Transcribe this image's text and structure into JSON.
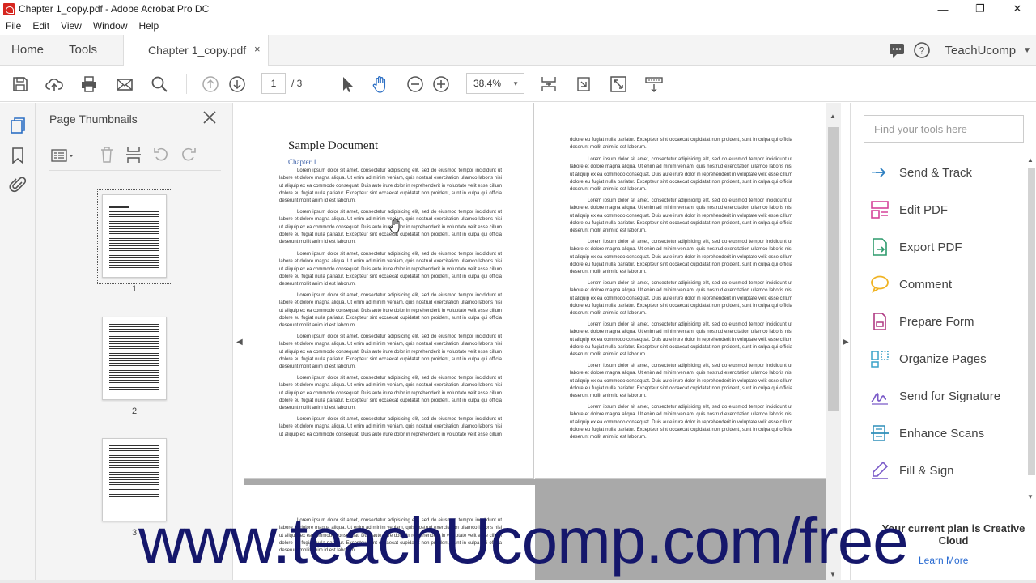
{
  "window": {
    "title": "Chapter 1_copy.pdf - Adobe Acrobat Pro DC",
    "minimize": "—",
    "maximize": "❐",
    "close": "✕"
  },
  "menu": [
    "File",
    "Edit",
    "View",
    "Window",
    "Help"
  ],
  "tabs": {
    "home": "Home",
    "tools": "Tools",
    "document": "Chapter 1_copy.pdf",
    "close": "×",
    "account": "TeachUcomp"
  },
  "toolbar": {
    "current_page": "1",
    "page_total": "/ 3",
    "zoom": "38.4%"
  },
  "thumbnails": {
    "title": "Page Thumbnails",
    "pages": [
      "1",
      "2",
      "3"
    ]
  },
  "document": {
    "title": "Sample Document",
    "subtitle": "Chapter 1",
    "lorem": "Lorem ipsum dolor sit amet, consectetur adipisicing elit, sed do eiusmod tempor incididunt ut labore et dolore magna aliqua. Ut enim ad minim veniam, quis nostrud exercitation ullamco laboris nisi ut aliquip ex ea commodo consequat. Duis aute irure dolor in reprehenderit in voluptate velit esse cillum dolore eu fugiat nulla pariatur. Excepteur sint occaecat cupidatat non proident, sunt in culpa qui officia deserunt mollit anim id est laborum.",
    "lorem_tail": "dolore eu fugiat nulla pariatur. Excepteur sint occaecat cupidatat non proident, sunt in culpa qui officia deserunt mollit anim id est laborum.",
    "lorem_short": "Lorem ipsum dolor sit amet, consectetur adipisicing elit, sed do eiusmod tempor incididunt ut labore et dolore magna aliqua. Ut enim ad minim veniam, quis nostrud exercitation ullamco laboris nisi ut aliquip ex ea commodo consequat. Duis aute irure dolor in reprehenderit in voluptate velit esse cillum"
  },
  "tools_pane": {
    "search_placeholder": "Find your tools here",
    "items": [
      {
        "label": "Send & Track",
        "icon": "send-track-icon",
        "color": "#2d7fc1"
      },
      {
        "label": "Edit PDF",
        "icon": "edit-pdf-icon",
        "color": "#d5439a"
      },
      {
        "label": "Export PDF",
        "icon": "export-pdf-icon",
        "color": "#2e9b6d"
      },
      {
        "label": "Comment",
        "icon": "comment-icon",
        "color": "#f0b323"
      },
      {
        "label": "Prepare Form",
        "icon": "prepare-form-icon",
        "color": "#b03a83"
      },
      {
        "label": "Organize Pages",
        "icon": "organize-pages-icon",
        "color": "#3aa2c8"
      },
      {
        "label": "Send for Signature",
        "icon": "send-signature-icon",
        "color": "#7a5ac8"
      },
      {
        "label": "Enhance Scans",
        "icon": "enhance-scans-icon",
        "color": "#2f8fba"
      },
      {
        "label": "Fill & Sign",
        "icon": "fill-sign-icon",
        "color": "#7a5ac8"
      }
    ],
    "plan_text": "Your current plan is Creative Cloud",
    "learn_more": "Learn More"
  },
  "watermark": "www.teachUcomp.com/free"
}
